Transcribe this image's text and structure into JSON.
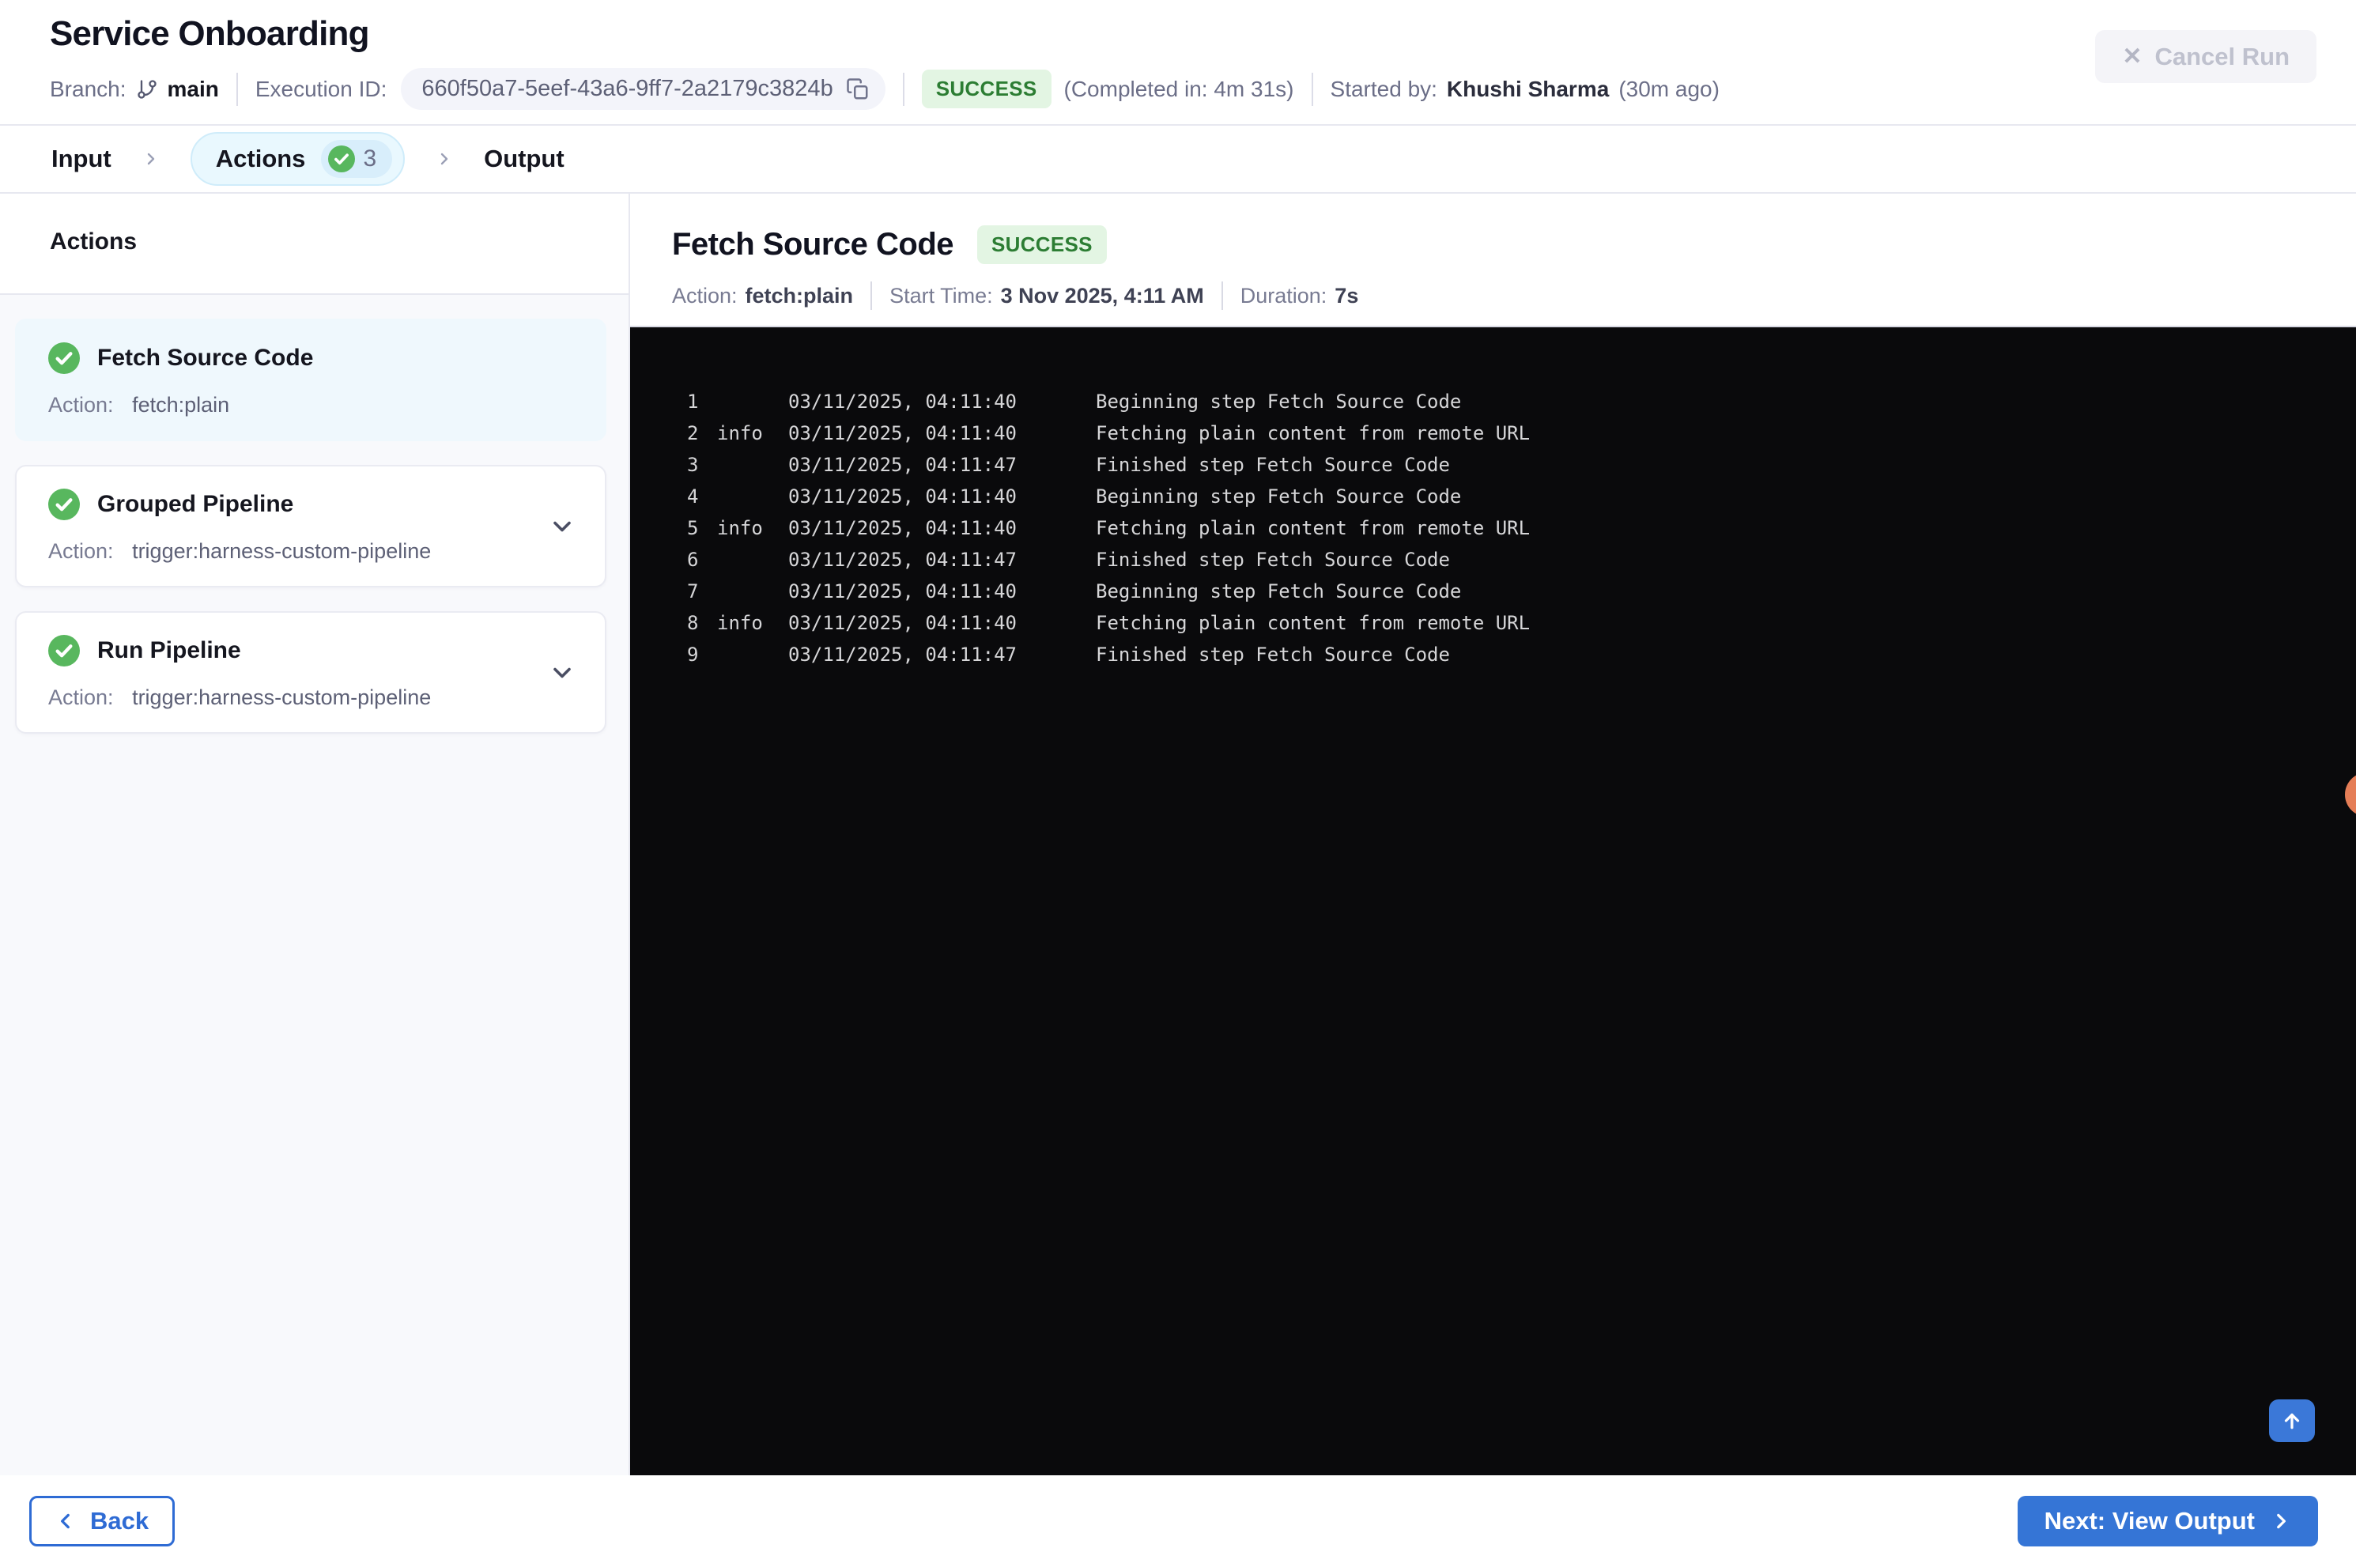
{
  "header": {
    "title": "Service Onboarding",
    "branch_label": "Branch:",
    "branch_name": "main",
    "execution_id_label": "Execution ID:",
    "execution_id": "660f50a7-5eef-43a6-9ff7-2a2179c3824b",
    "status": "SUCCESS",
    "completed_in": "(Completed in: 4m 31s)",
    "started_by_label": "Started by:",
    "started_by": "Khushi Sharma",
    "started_ago": "(30m ago)",
    "cancel_button": "Cancel Run"
  },
  "tabs": {
    "input": "Input",
    "actions": "Actions",
    "actions_count": "3",
    "output": "Output"
  },
  "sidebar": {
    "heading": "Actions",
    "action_label": "Action:",
    "cards": [
      {
        "title": "Fetch Source Code",
        "action": "fetch:plain",
        "selected": true,
        "expandable": false
      },
      {
        "title": "Grouped Pipeline",
        "action": "trigger:harness-custom-pipeline",
        "selected": false,
        "expandable": true
      },
      {
        "title": "Run Pipeline",
        "action": "trigger:harness-custom-pipeline",
        "selected": false,
        "expandable": true
      }
    ]
  },
  "detail": {
    "title": "Fetch Source Code",
    "status": "SUCCESS",
    "action_label": "Action:",
    "action_value": "fetch:plain",
    "start_label": "Start Time:",
    "start_value": "3 Nov 2025, 4:11 AM",
    "duration_label": "Duration:",
    "duration_value": "7s"
  },
  "log": {
    "lines": [
      {
        "num": "1",
        "level": "",
        "time": "03/11/2025, 04:11:40",
        "msg": "Beginning step Fetch Source Code"
      },
      {
        "num": "2",
        "level": "info",
        "time": "03/11/2025, 04:11:40",
        "msg": "Fetching plain content from remote URL"
      },
      {
        "num": "3",
        "level": "",
        "time": "03/11/2025, 04:11:47",
        "msg": "Finished step Fetch Source Code"
      },
      {
        "num": "4",
        "level": "",
        "time": "03/11/2025, 04:11:40",
        "msg": "Beginning step Fetch Source Code"
      },
      {
        "num": "5",
        "level": "info",
        "time": "03/11/2025, 04:11:40",
        "msg": "Fetching plain content from remote URL"
      },
      {
        "num": "6",
        "level": "",
        "time": "03/11/2025, 04:11:47",
        "msg": "Finished step Fetch Source Code"
      },
      {
        "num": "7",
        "level": "",
        "time": "03/11/2025, 04:11:40",
        "msg": "Beginning step Fetch Source Code"
      },
      {
        "num": "8",
        "level": "info",
        "time": "03/11/2025, 04:11:40",
        "msg": "Fetching plain content from remote URL"
      },
      {
        "num": "9",
        "level": "",
        "time": "03/11/2025, 04:11:47",
        "msg": "Finished step Fetch Source Code"
      }
    ]
  },
  "footer": {
    "back_button": "Back",
    "next_button": "Next: View Output"
  },
  "icons": {
    "cancel_x": "✕",
    "branch": "git-branch",
    "copy": "copy",
    "check": "check-circle",
    "chevron_right": "›",
    "chevron_down": "⌄",
    "back_arrow": "‹",
    "next_arrow": "›",
    "scroll_top": "↑"
  },
  "colors": {
    "accent_blue": "#3575d6",
    "success_text": "#2c7d33",
    "success_bg": "#e3f5e3",
    "check_green": "#58b75e",
    "tab_pill_bg": "#e9f8fe",
    "log_bg": "#0a0a0c",
    "notification_orange": "#e57e57"
  }
}
